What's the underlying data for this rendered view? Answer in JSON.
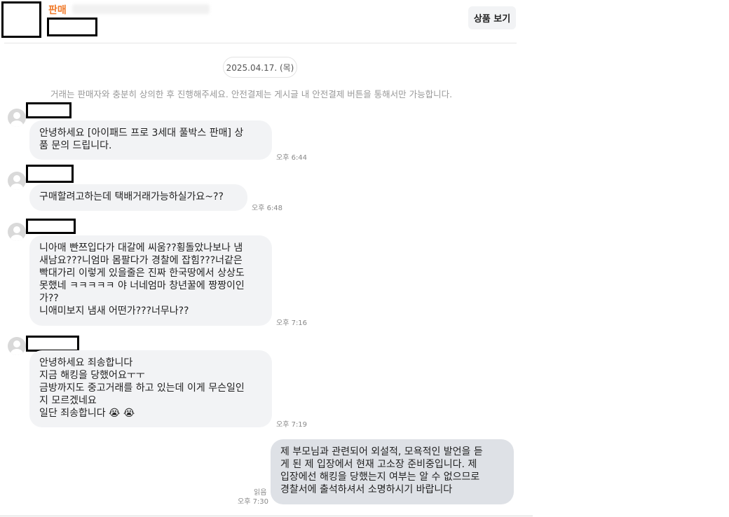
{
  "header": {
    "tag": "판매",
    "view_button": "상품 보기"
  },
  "chat": {
    "date": "2025.04.17. (목)",
    "notice": "거래는 판매자와 충분히 상의한 후 진행해주세요. 안전결제는 게시글 내 안전결제 버튼을 통해서만 가능합니다.",
    "messages": [
      {
        "text": "안녕하세요 [아이패드 프로 3세대 풀박스 판매] 상\n품 문의 드립니다.",
        "time": "오후 6:44"
      },
      {
        "text": "구매할려고하는데 택배거래가능하실가요~??",
        "time": "오후 6:48"
      },
      {
        "text": "니아매 빤쯔입다가 대갈에 씨움??횡돌았나보나 냄\n새남요???니엄마 몸팔다가 경찰에 잡힘???너같은\n빡대가리 이렇게 있을줄은 진짜 한국땅에서 상상도\n못했네 ㅋㅋㅋㅋㅋ 야 너네엄마 창년꿀에 짱짱이인\n가??\n니애미보지 냄새 어떤가???너무나??",
        "time": "오후 7:16"
      },
      {
        "text": "안녕하세요 죄송합니다\n지금 해킹을 당했어요ㅜㅜ\n금방까지도 중고거래를 하고 있는데 이게 무슨일인\n지 모르겠네요\n일단 죄송합니다 😭 😭",
        "time": "오후 7:19"
      },
      {
        "text": "제 부모님과 관련되어 외설적, 모욕적인 발언을 듣\n게 된 제 입장에서 현재 고소장 준비중입니다. 제\n입장에선 해킹을 당했는지 여부는 알 수 없으므로\n경찰서에 출석하셔서 소명하시기 바랍니다",
        "time": "오후 7:30",
        "read": "읽음"
      }
    ]
  },
  "colors": {
    "accent": "#f07a2a",
    "bubble_other": "#f2f3f5",
    "bubble_mine": "#dee1e6"
  },
  "icons": {
    "avatar": "default-profile-icon"
  }
}
